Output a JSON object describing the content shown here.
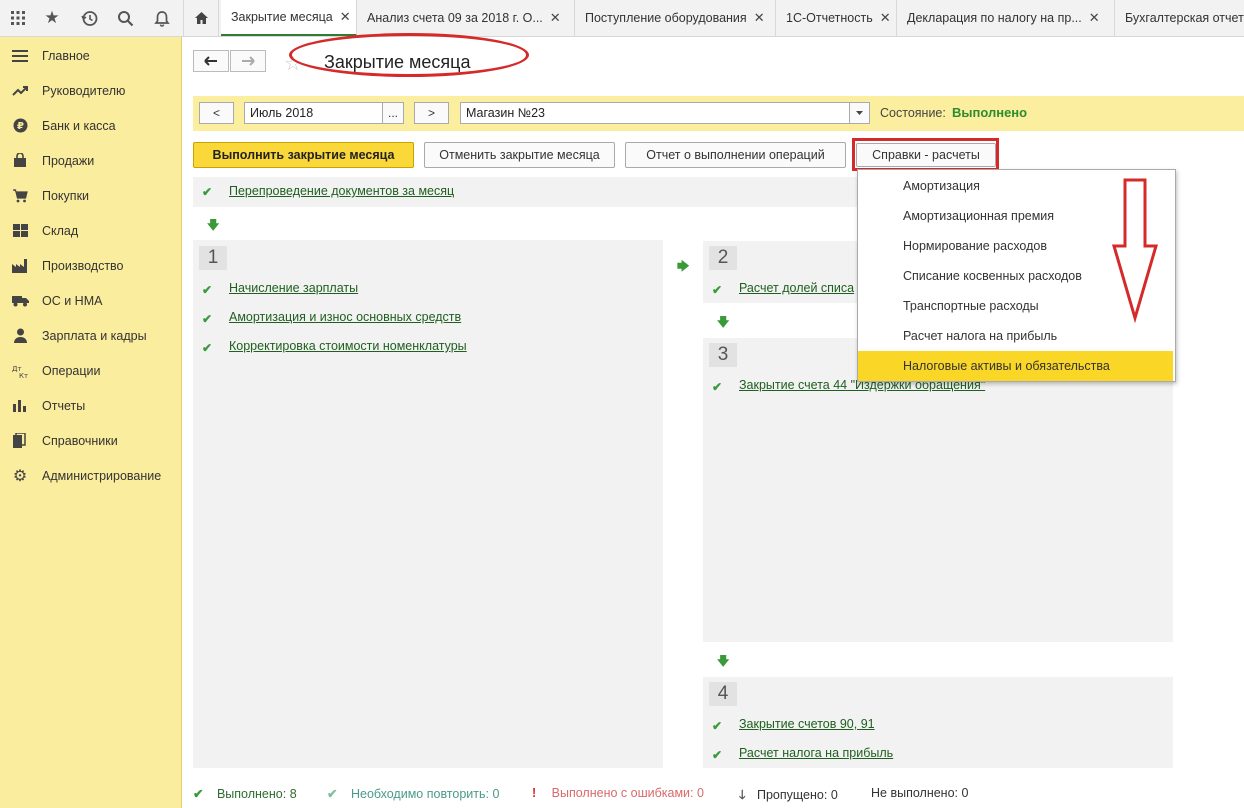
{
  "topbar": {
    "icons": [
      "apps-grid-icon",
      "star-icon",
      "history-icon",
      "search-icon",
      "bell-icon",
      "home-icon"
    ],
    "tabs": [
      {
        "label": "Закрытие месяца",
        "closable": true,
        "active": true
      },
      {
        "label": "Анализ счета 09 за 2018 г. О...",
        "closable": true,
        "active": false
      },
      {
        "label": "Поступление оборудования",
        "closable": true,
        "active": false
      },
      {
        "label": "1С-Отчетность",
        "closable": true,
        "active": false
      },
      {
        "label": "Декларация по налогу на пр...",
        "closable": true,
        "active": false
      },
      {
        "label": "Бухгалтерская отчет",
        "closable": false,
        "active": false
      }
    ],
    "close_glyph": "✕"
  },
  "sidebar": {
    "items": [
      {
        "label": "Главное",
        "icon": "menu-lines-icon"
      },
      {
        "label": "Руководителю",
        "icon": "trend-icon"
      },
      {
        "label": "Банк и касса",
        "icon": "ruble-coin-icon"
      },
      {
        "label": "Продажи",
        "icon": "shopping-bag-icon"
      },
      {
        "label": "Покупки",
        "icon": "cart-icon"
      },
      {
        "label": "Склад",
        "icon": "warehouse-grid-icon"
      },
      {
        "label": "Производство",
        "icon": "factory-icon"
      },
      {
        "label": "ОС и НМА",
        "icon": "truck-icon"
      },
      {
        "label": "Зарплата и кадры",
        "icon": "person-icon"
      },
      {
        "label": "Операции",
        "icon": "dt-kt-icon"
      },
      {
        "label": "Отчеты",
        "icon": "bar-chart-icon"
      },
      {
        "label": "Справочники",
        "icon": "books-icon"
      },
      {
        "label": "Администрирование",
        "icon": "gear-icon"
      }
    ]
  },
  "page": {
    "title": "Закрытие месяца",
    "back_glyph": "🡐",
    "forward_glyph": "🡒"
  },
  "filter": {
    "prev_label": "<",
    "period_value": "Июль 2018",
    "period_ellipsis": "...",
    "next_label": ">",
    "org_value": "Магазин №23",
    "state_label": "Состояние:",
    "state_value": "Выполнено"
  },
  "actions": {
    "run": "Выполнить закрытие месяца",
    "cancel": "Отменить закрытие месяца",
    "report": "Отчет о выполнении операций",
    "calc": "Справки - расчеты"
  },
  "steps": {
    "top": "Перепроведение документов за месяц",
    "s1": {
      "num": "1",
      "items": [
        "Начисление зарплаты",
        "Амортизация и износ основных средств",
        "Корректировка стоимости номенклатуры"
      ]
    },
    "s2": {
      "num": "2",
      "items": [
        "Расчет долей списа"
      ]
    },
    "s3": {
      "num": "3",
      "items": [
        "Закрытие счета 44 \"Издержки обращения\""
      ]
    },
    "s4": {
      "num": "4",
      "items": [
        "Закрытие счетов 90, 91",
        "Расчет налога на прибыль"
      ]
    }
  },
  "dropdown": {
    "items": [
      "Амортизация",
      "Амортизационная премия",
      "Нормирование расходов",
      "Списание косвенных расходов",
      "Транспортные расходы",
      "Расчет налога на прибыль",
      "Налоговые активы и обязательства"
    ],
    "selected_index": 6
  },
  "footer": {
    "done_label": "Выполнено:",
    "done_count": "8",
    "repeat_label": "Необходимо повторить:",
    "repeat_count": "0",
    "error_label": "Выполнено с ошибками:",
    "error_count": "0",
    "skipped_label": "Пропущено:",
    "skipped_count": "0",
    "notdone_label": "Не выполнено:",
    "notdone_count": "0"
  },
  "colors": {
    "accent_yellow": "#fad83a",
    "sidebar_bg": "#fbed9e",
    "success_green": "#3a9a3a",
    "annotation_red": "#d52a2a"
  }
}
